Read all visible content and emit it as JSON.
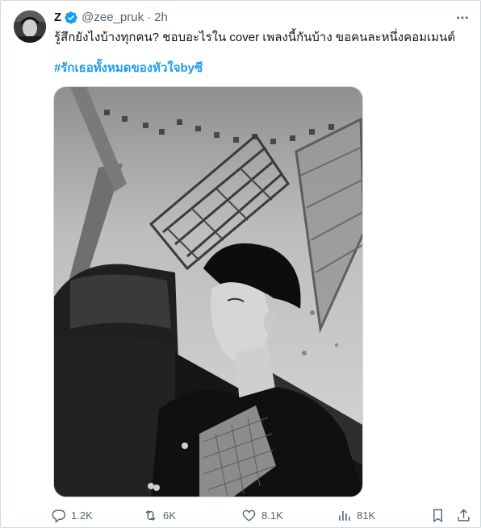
{
  "post": {
    "author_name": "Z",
    "handle": "@zee_pruk",
    "separator": "·",
    "time": "2h",
    "text": "รู้สึกยังไงบ้างทุกคน? ชอบอะไรใน cover เพลงนี้กันบ้าง ขอคนละหนึ่งคอมเมนต์",
    "hashtag": "#รักเธอทั้งหมดของหัวใจbyซี",
    "verified": true
  },
  "icons": {
    "more": "more-horizontal-icon",
    "verified": "verified-badge-icon",
    "reply": "reply-icon",
    "repost": "repost-icon",
    "like": "like-icon",
    "views": "views-icon",
    "bookmark": "bookmark-icon",
    "share": "share-icon"
  },
  "actions": {
    "replies": "1.2K",
    "reposts": "6K",
    "likes": "8.1K",
    "views": "81K"
  },
  "colors": {
    "accent": "#1d9bf0",
    "muted": "#536471",
    "text": "#0f1419",
    "border": "#cfd9de"
  }
}
